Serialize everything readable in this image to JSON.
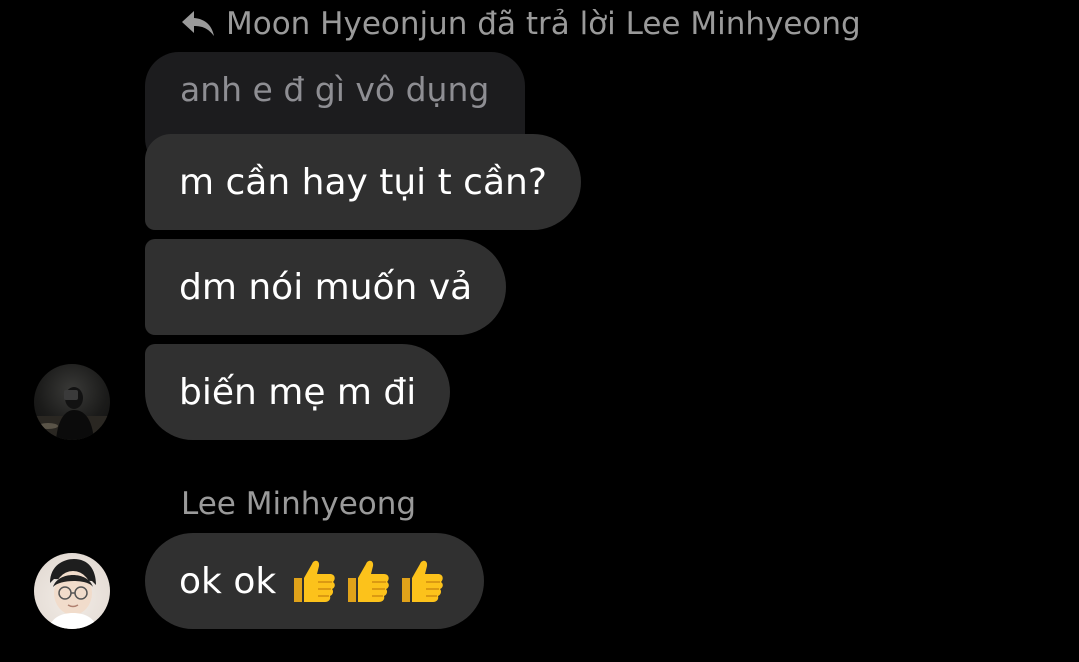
{
  "reply_header": {
    "text": "Moon Hyeonjun đã trả lời Lee Minhyeong",
    "icon": "reply-arrow-icon"
  },
  "quoted_message": {
    "text": "anh e đ gì vô dụng"
  },
  "messages_group1": [
    {
      "text": "m cần hay tụi t cần?"
    },
    {
      "text": "dm nói muốn vả"
    },
    {
      "text": "biến mẹ m đi"
    }
  ],
  "sender2": {
    "name": "Lee Minhyeong"
  },
  "message2": {
    "text": "ok ok",
    "emoji": "thumbs-up-icon",
    "emoji_count": 3
  },
  "colors": {
    "background": "#000000",
    "bubble": "#303030",
    "quoted_bubble": "#1c1c1e",
    "muted_text": "#9a9a9a"
  }
}
